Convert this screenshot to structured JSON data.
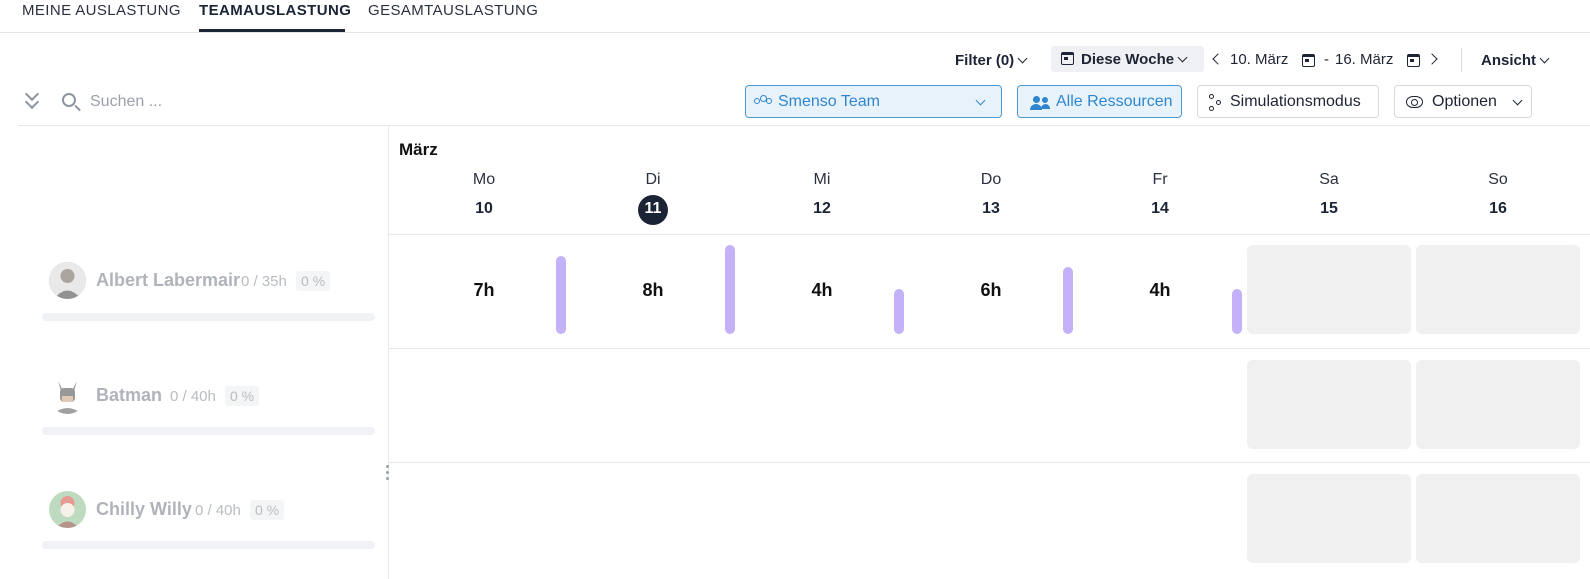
{
  "tabs": [
    {
      "label": "MEINE AUSLASTUNG",
      "active": false
    },
    {
      "label": "TEAMAUSLASTUNG",
      "active": true
    },
    {
      "label": "GESAMTAUSLASTUNG",
      "active": false
    }
  ],
  "toolbar": {
    "filter_label": "Filter (0)",
    "week_label": "Diese Woche",
    "date_from": "10. März",
    "date_separator": "-",
    "date_to": "16. März",
    "view_label": "Ansicht"
  },
  "search": {
    "placeholder": "Suchen ..."
  },
  "team_select": {
    "selected": "Smenso Team"
  },
  "resources_button": "Alle Ressourcen",
  "simulation_button": "Simulationsmodus",
  "options_button": "Optionen",
  "calendar": {
    "month": "März",
    "days": [
      {
        "name": "Mo",
        "num": "10",
        "today": false,
        "weekend": false
      },
      {
        "name": "Di",
        "num": "11",
        "today": true,
        "weekend": false
      },
      {
        "name": "Mi",
        "num": "12",
        "today": false,
        "weekend": false
      },
      {
        "name": "Do",
        "num": "13",
        "today": false,
        "weekend": false
      },
      {
        "name": "Fr",
        "num": "14",
        "today": false,
        "weekend": false
      },
      {
        "name": "Sa",
        "num": "15",
        "today": false,
        "weekend": true
      },
      {
        "name": "So",
        "num": "16",
        "today": false,
        "weekend": true
      }
    ]
  },
  "resources": [
    {
      "name": "Albert Labermair",
      "hours": "0 / 35h",
      "percent": "0 %",
      "daily_hours": [
        "7h",
        "8h",
        "4h",
        "6h",
        "4h"
      ],
      "daily_load": [
        7,
        8,
        4,
        6,
        4
      ]
    },
    {
      "name": "Batman",
      "hours": "0 / 40h",
      "percent": "0 %",
      "daily_hours": [],
      "daily_load": []
    },
    {
      "name": "Chilly Willy",
      "hours": "0 / 40h",
      "percent": "0 %",
      "daily_hours": [],
      "daily_load": []
    }
  ],
  "colors": {
    "accent": "#2f86cf",
    "load_bar": "#c4b1f7",
    "today": "#1b2435"
  }
}
